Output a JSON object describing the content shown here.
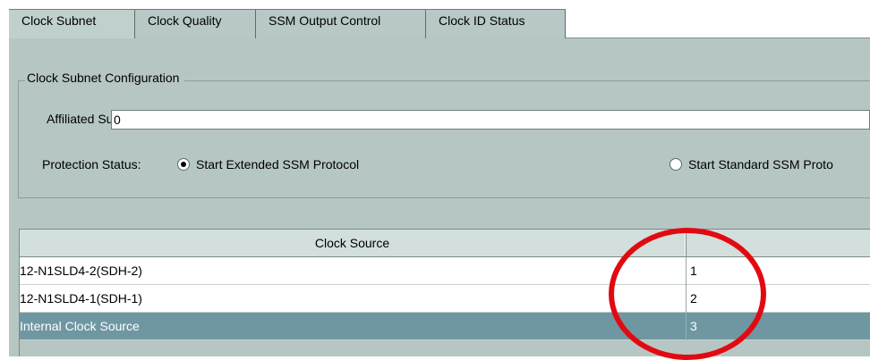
{
  "tabs": [
    {
      "label": "Clock Subnet",
      "active": true
    },
    {
      "label": "Clock Quality",
      "active": false
    },
    {
      "label": "SSM Output Control",
      "active": false
    },
    {
      "label": "Clock ID Status",
      "active": false
    }
  ],
  "config": {
    "legend": "Clock Subnet Configuration",
    "affiliated_subnet_label": "Affiliated Subnet:",
    "affiliated_subnet_value": "0",
    "protection_status_label": "Protection Status:",
    "option_extended": "Start Extended SSM Protocol",
    "option_standard": "Start Standard SSM Proto",
    "selected_option": "extended"
  },
  "table": {
    "headers": [
      "Clock Source",
      ""
    ],
    "rows": [
      {
        "source": "12-N1SLD4-2(SDH-2)",
        "priority": "1",
        "selected": false
      },
      {
        "source": "12-N1SLD4-1(SDH-1)",
        "priority": "2",
        "selected": false
      },
      {
        "source": "Internal Clock Source",
        "priority": "3",
        "selected": true
      }
    ]
  },
  "colors": {
    "panel_bg": "#b6c6c3",
    "selection": "#6f97a2",
    "annotation_ring": "#e20a12"
  }
}
